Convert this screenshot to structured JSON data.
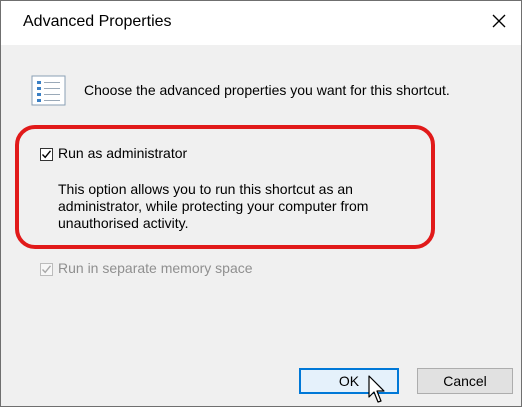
{
  "window": {
    "title": "Advanced Properties",
    "close_glyph": "✕"
  },
  "header": {
    "icon": "properties-list-icon",
    "text": "Choose the advanced properties you want for this shortcut."
  },
  "options": {
    "run_as_admin": {
      "label": "Run as administrator",
      "checked": true,
      "enabled": true,
      "description": "This option allows you to run this shortcut as an administrator, while protecting your computer from unauthorised activity."
    },
    "separate_memory": {
      "label": "Run in separate memory space",
      "checked": true,
      "enabled": false
    }
  },
  "buttons": {
    "ok_label": "OK",
    "cancel_label": "Cancel"
  },
  "colors": {
    "highlight": "#e11a1a",
    "focus_border": "#0078d7",
    "dialog_bg": "#f0f0f0"
  }
}
